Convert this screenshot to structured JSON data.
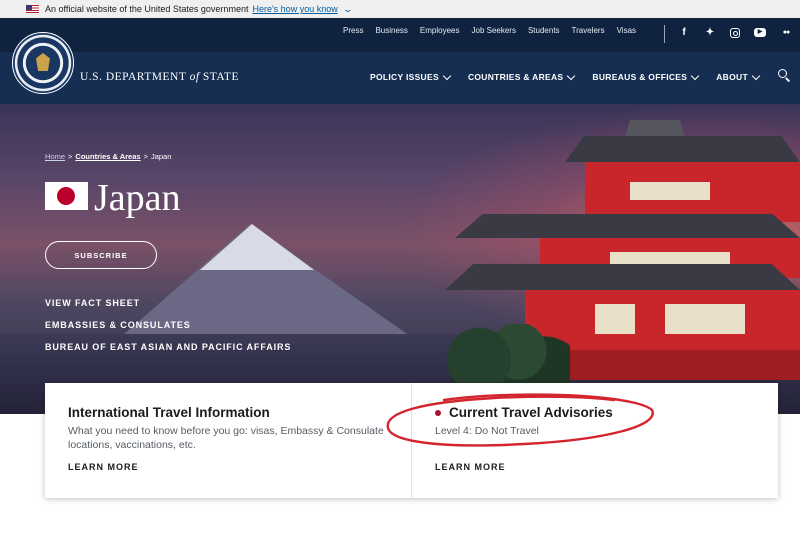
{
  "gov_banner": {
    "text": "An official website of the United States government",
    "link": "Here's how you know"
  },
  "header": {
    "dept_name_pre": "U.S. DEPARTMENT ",
    "dept_name_of": "of",
    "dept_name_post": " STATE",
    "utility_nav": [
      "Press",
      "Business",
      "Employees",
      "Job Seekers",
      "Students",
      "Travelers",
      "Visas"
    ],
    "social": [
      "facebook-icon",
      "twitter-icon",
      "instagram-icon",
      "youtube-icon",
      "flickr-icon"
    ],
    "main_nav": [
      "POLICY ISSUES",
      "COUNTRIES & AREAS",
      "BUREAUS & OFFICES",
      "ABOUT"
    ]
  },
  "hero": {
    "breadcrumb": {
      "home": "Home",
      "sep1": ">",
      "countries": "Countries & Areas",
      "sep2": ">",
      "current": "Japan"
    },
    "title": "Japan",
    "subscribe": "SUBSCRIBE",
    "links": [
      "VIEW FACT SHEET",
      "EMBASSIES & CONSULATES",
      "BUREAU OF EAST ASIAN AND PACIFIC AFFAIRS"
    ]
  },
  "cards": [
    {
      "title": "International Travel Information",
      "desc": "What you need to know before you go: visas, Embassy & Consulate locations, vaccinations, etc.",
      "link": "LEARN MORE"
    },
    {
      "title": "Current Travel Advisories",
      "desc": "Level 4: Do Not Travel",
      "link": "LEARN MORE"
    }
  ],
  "colors": {
    "header_bg": "#162e51",
    "advisory_dot": "#a8102c",
    "annotation_circle": "#d4242d"
  }
}
